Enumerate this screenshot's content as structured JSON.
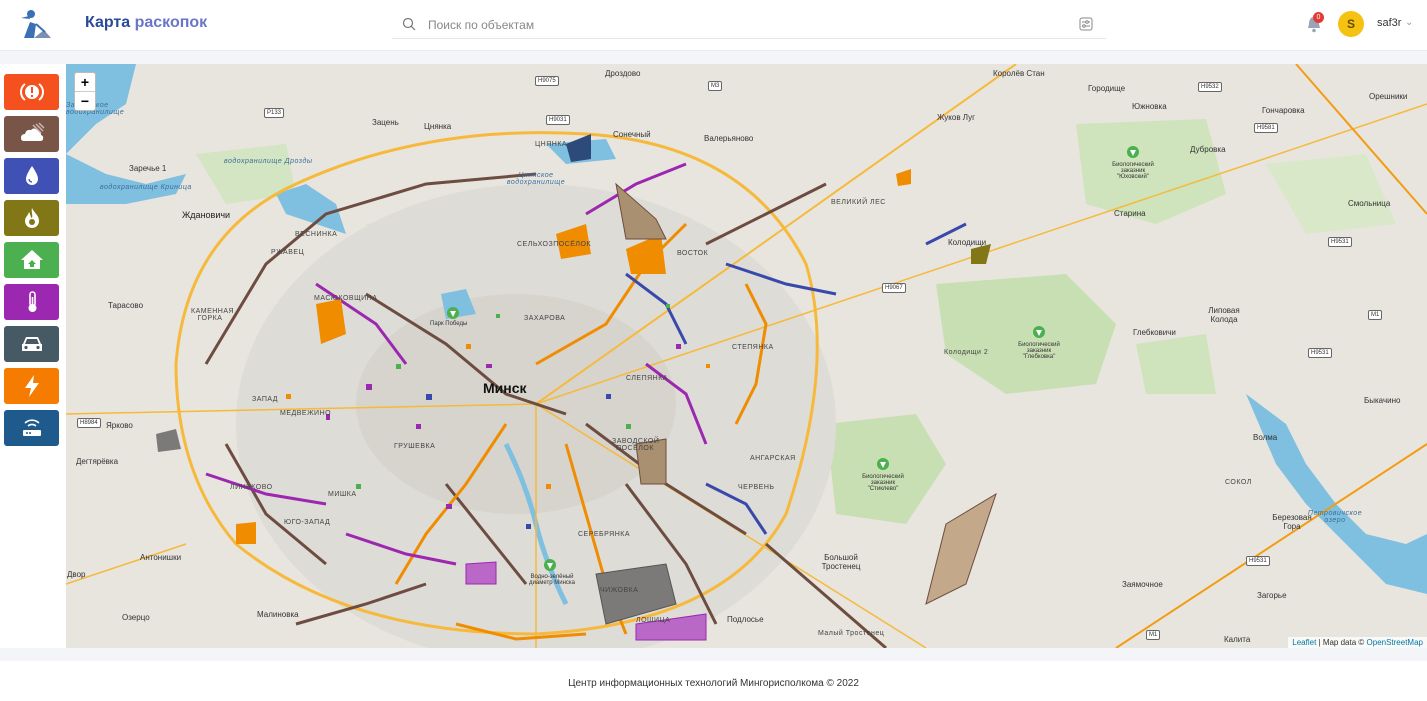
{
  "app": {
    "title_part1": "Карта",
    "title_part2": " раскопок"
  },
  "search": {
    "placeholder": "Поиск по объектам"
  },
  "notifications": {
    "count": "0"
  },
  "user": {
    "initial": "S",
    "name": "saf3r"
  },
  "layers": [
    {
      "id": "emergency",
      "icon": "alert-icon",
      "color": "#f4511e"
    },
    {
      "id": "weather",
      "icon": "cloud-icon",
      "color": "#795548"
    },
    {
      "id": "water",
      "icon": "water-drop-icon",
      "color": "#3f51b5"
    },
    {
      "id": "gas",
      "icon": "flame-icon",
      "color": "#827717"
    },
    {
      "id": "housing",
      "icon": "house-icon",
      "color": "#4caf50"
    },
    {
      "id": "heat",
      "icon": "thermometer-icon",
      "color": "#9c27b0"
    },
    {
      "id": "roads",
      "icon": "car-icon",
      "color": "#455a64"
    },
    {
      "id": "power",
      "icon": "lightning-icon",
      "color": "#f57c00"
    },
    {
      "id": "telecom",
      "icon": "router-icon",
      "color": "#1e5a8c"
    }
  ],
  "map": {
    "zoom_in": "+",
    "zoom_out": "−",
    "attribution_leaflet": "Leaflet",
    "attribution_text": " | Map data © ",
    "attribution_osm": "OpenStreetMap",
    "city_label": "Минск",
    "places": [
      "Дроздово",
      "Королёв Стан",
      "Городище",
      "Южновка",
      "Гончаровка",
      "Орешники",
      "Зацень",
      "Цнянка",
      "Сонечный",
      "Валерьяново",
      "Жуков Луг",
      "Дубровка",
      "Заречье 1",
      "Ждановичи",
      "Старина",
      "Смольница",
      "Колодищи",
      "Тарасово",
      "Глебковичи",
      "Липовая Колода",
      "Колодищи 2",
      "Быкачино",
      "Ярково",
      "Волма",
      "Дегтярёвка",
      "Антонишки",
      "Березовая Гора",
      "Двор",
      "Большой Тростенец",
      "Заямочное",
      "Загорье",
      "Озерцо",
      "Малиновка",
      "Подлосье",
      "Малый Тростенец",
      "Калита",
      "Парк Победы",
      "Водно-зелёный диаметр Минска"
    ],
    "districts": [
      "ВЕСНИНКА",
      "РЖАВЕЦ",
      "СЕЛЬХОЗПОСЁЛОК",
      "ВОСТОК",
      "ВЕЛИКИЙ ЛЕС",
      "МАСЮКОВЩИНА",
      "КАМЕННАЯ ГОРКА",
      "ЗАХАРОВА",
      "СТЕПЯНКА",
      "СЛЕПЯНКА",
      "ЗАПАД",
      "МЕДВЕЖИНО",
      "ГРУШЕВКА",
      "ЗАВОДСКОЙ ПОСЁЛОК",
      "АНГАРСКАЯ",
      "ЛИНЬКОВО",
      "МИШКА",
      "ЮГО-ЗАПАД",
      "ЧЕРВЕНЬ",
      "СЕРЕБРЯНКА",
      "ЧИЖОВКА",
      "СОКОЛ",
      "ЦНЯНКА",
      "ЛОШИЦА"
    ],
    "water_labels": [
      "водохранилище Дрозды",
      "водохранилище Криница",
      "Цнянское водохранилище",
      "Петровичское озеро",
      "Заславское водохранилище"
    ],
    "reserves": [
      {
        "line1": "Биологический",
        "line2": "заказник",
        "line3": "\"Юховский\""
      },
      {
        "line1": "Биологический",
        "line2": "заказник",
        "line3": "\"Глебковка\""
      },
      {
        "line1": "Биологический",
        "line2": "заказник",
        "line3": "\"Стиклево\""
      }
    ],
    "road_shields": [
      "H9075",
      "M3",
      "H9532",
      "H9581",
      "P133",
      "H9031",
      "H9067",
      "H9531",
      "M1",
      "H9531",
      "H8984",
      "H9531",
      "M1"
    ]
  },
  "footer": {
    "text": "Центр информационных технологий Мингорисполкома © 2022"
  }
}
